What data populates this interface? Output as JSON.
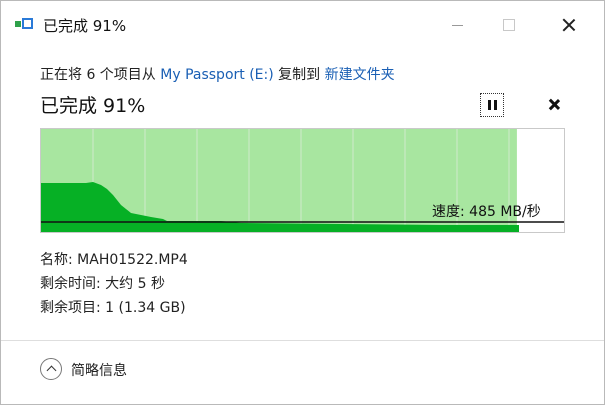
{
  "window": {
    "title": "已完成 91%",
    "controls": {
      "minimize": "minimize",
      "maximize": "maximize",
      "close": "close"
    }
  },
  "header": {
    "copy_prefix": "正在将 6 个项目从 ",
    "source": "My Passport (E:)",
    "copy_middle": " 复制到 ",
    "destination": "新建文件夹",
    "percent_text": "已完成 91%"
  },
  "progress": {
    "percent": 91,
    "speed_label": "速度: 485 MB/秒",
    "colors": {
      "fill": "#a8e6a0",
      "graph": "#06b025",
      "line": "#111111",
      "grid": "#cfe9cc"
    }
  },
  "details": {
    "name_label": "名称: ",
    "name_value": "MAH01522.MP4",
    "time_label": "剩余时间: ",
    "time_value": "大约 5 秒",
    "items_label": "剩余项目: ",
    "items_value": "1 (1.34 GB)"
  },
  "footer": {
    "toggle_label": "简略信息",
    "icon": "chevron-up-icon"
  }
}
